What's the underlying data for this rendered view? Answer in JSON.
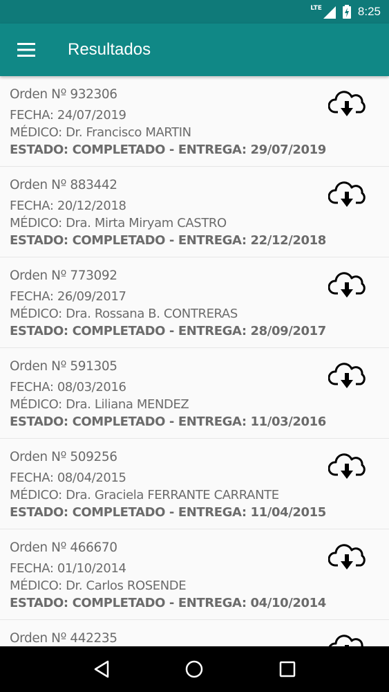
{
  "status_bar": {
    "network": "LTE",
    "time": "8:25"
  },
  "app_bar": {
    "title": "Resultados"
  },
  "results": [
    {
      "orden": "Orden Nº 932306",
      "fecha": "FECHA: 24/07/2019",
      "medico": "MÉDICO: Dr. Francisco MARTIN",
      "estado": "ESTADO: COMPLETADO -  ENTREGA: 29/07/2019"
    },
    {
      "orden": "Orden Nº 883442",
      "fecha": "FECHA: 20/12/2018",
      "medico": "MÉDICO: Dra. Mirta Miryam CASTRO",
      "estado": "ESTADO: COMPLETADO -  ENTREGA: 22/12/2018"
    },
    {
      "orden": "Orden Nº 773092",
      "fecha": "FECHA: 26/09/2017",
      "medico": "MÉDICO: Dra. Rossana B. CONTRERAS",
      "estado": "ESTADO: COMPLETADO -  ENTREGA: 28/09/2017"
    },
    {
      "orden": "Orden Nº 591305",
      "fecha": "FECHA: 08/03/2016",
      "medico": "MÉDICO: Dra. Liliana  MENDEZ",
      "estado": "ESTADO: COMPLETADO -  ENTREGA: 11/03/2016"
    },
    {
      "orden": "Orden Nº 509256",
      "fecha": "FECHA: 08/04/2015",
      "medico": "MÉDICO: Dra. Graciela FERRANTE CARRANTE",
      "estado": "ESTADO: COMPLETADO -  ENTREGA: 11/04/2015"
    },
    {
      "orden": "Orden Nº 466670",
      "fecha": "FECHA: 01/10/2014",
      "medico": "MÉDICO: Dr. Carlos ROSENDE",
      "estado": "ESTADO: COMPLETADO -  ENTREGA: 04/10/2014"
    },
    {
      "orden": "Orden Nº 442235",
      "fecha": "",
      "medico": "",
      "estado": ""
    }
  ],
  "icons": {
    "menu": "hamburger-menu-icon",
    "download": "cloud-download-icon",
    "nav_back": "triangle-back-icon",
    "nav_home": "circle-home-icon",
    "nav_recents": "square-recents-icon"
  },
  "colors": {
    "status_bar": "#0f7a79",
    "app_bar": "#108886",
    "text": "#6b6b6b",
    "background": "#fafafa"
  }
}
